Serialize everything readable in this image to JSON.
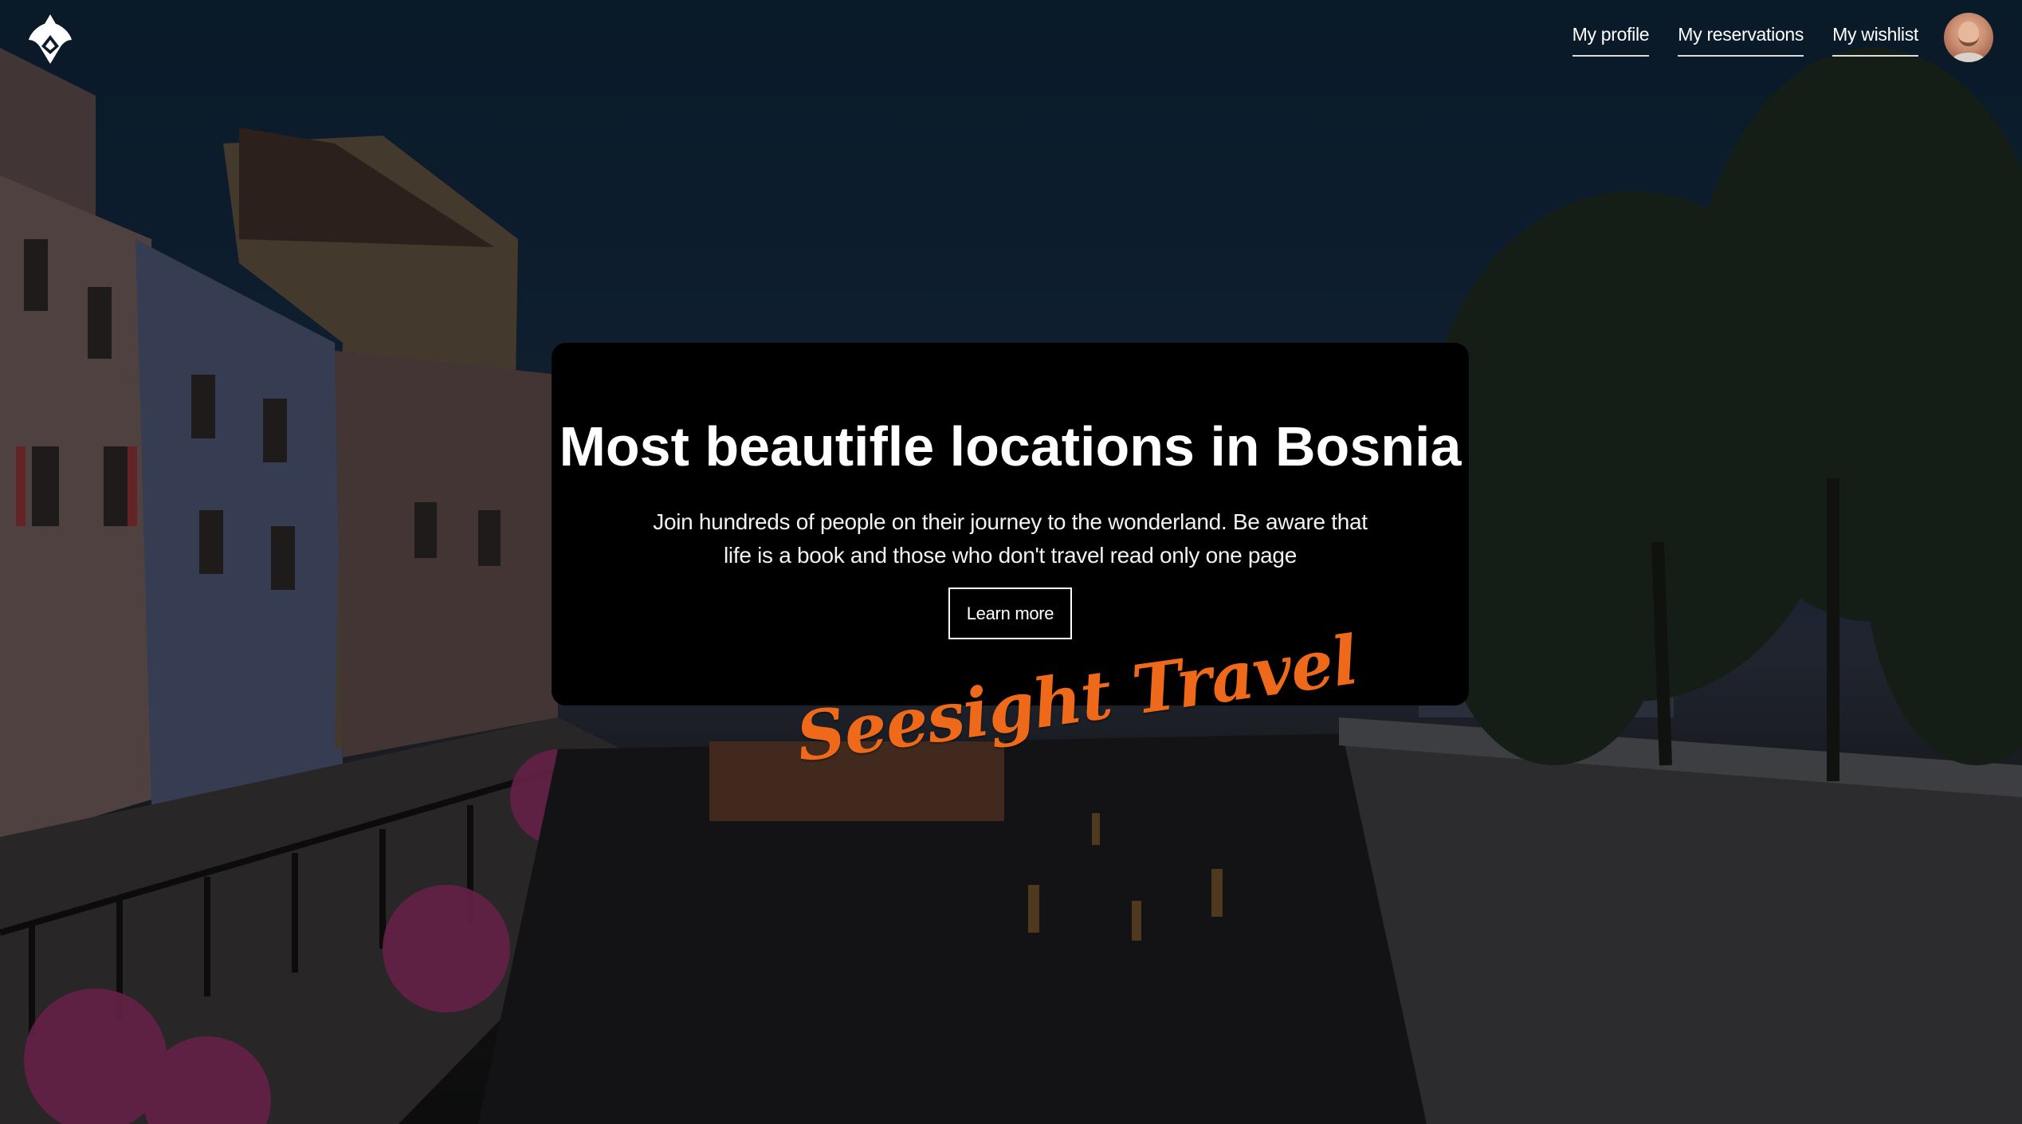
{
  "header": {
    "logo_icon": "ornament-logo-icon",
    "nav": [
      {
        "label": "My profile"
      },
      {
        "label": "My reservations"
      },
      {
        "label": "My wishlist"
      }
    ],
    "avatar": "user-avatar"
  },
  "hero": {
    "title": "Most beautifle locations in Bosnia",
    "text": "Join hundreds of people on their journey to the wonderland. Be aware that life is a book and those who don't travel read only one page",
    "button_label": "Learn more",
    "brand_script": "Seesight Travel"
  },
  "colors": {
    "accent": "#ee6a1a",
    "card": "#000000",
    "text": "#ffffff"
  }
}
